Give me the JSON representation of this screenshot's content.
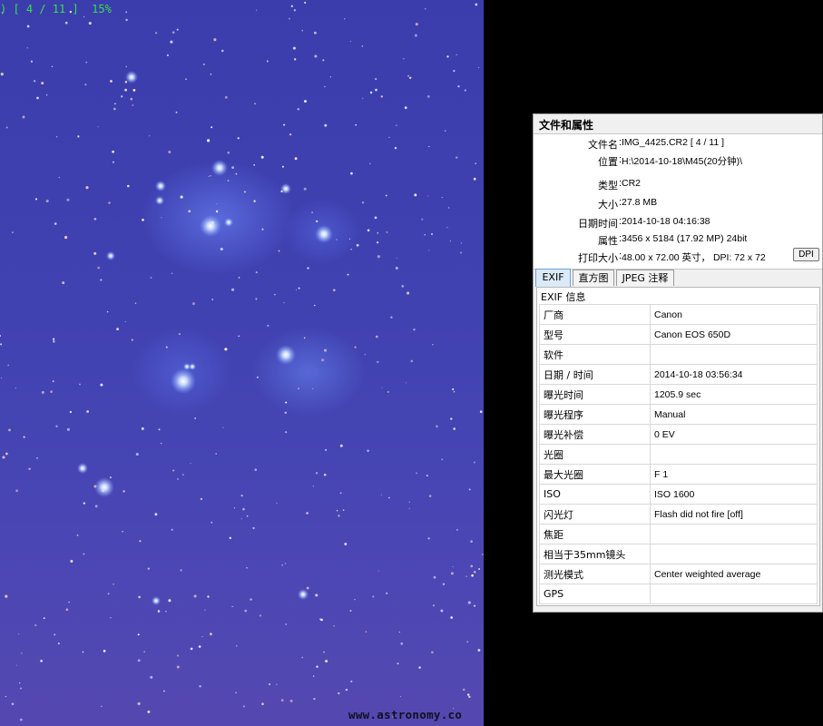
{
  "viewer": {
    "osd": ") [ 4 / 11 ]  15%",
    "watermark": "www.astronomy.co"
  },
  "panel": {
    "title": "文件和属性",
    "properties": [
      {
        "label": "文件名",
        "value": "IMG_4425.CR2   [ 4 / 11 ]"
      },
      {
        "label": "位置",
        "value": "H:\\2014-10-18\\M45(20分钟)\\"
      },
      {
        "label": "类型",
        "value": "CR2"
      },
      {
        "label": "大小",
        "value": "27.8 MB"
      },
      {
        "label": "日期时间",
        "value": "2014-10-18 04:16:38"
      },
      {
        "label": "属性",
        "value": "3456 x 5184 (17.92 MP)  24bit"
      },
      {
        "label": "打印大小",
        "value": "48.00 x 72.00 英寸，  DPI: 72 x 72"
      }
    ],
    "dpi_button": "DPI",
    "tabs": [
      "EXIF",
      "直方图",
      "JPEG 注释"
    ],
    "active_tab": "EXIF",
    "exif_heading": "EXIF 信息",
    "exif": [
      {
        "key": "厂商",
        "value": "Canon"
      },
      {
        "key": "型号",
        "value": "Canon EOS 650D"
      },
      {
        "key": "软件",
        "value": ""
      },
      {
        "key": "日期 / 时间",
        "value": "2014-10-18 03:56:34"
      },
      {
        "key": "曝光时间",
        "value": "1205.9 sec"
      },
      {
        "key": "曝光程序",
        "value": "Manual"
      },
      {
        "key": "曝光补偿",
        "value": "0 EV"
      },
      {
        "key": "光圈",
        "value": ""
      },
      {
        "key": "最大光圈",
        "value": "F 1"
      },
      {
        "key": "ISO",
        "value": "ISO 1600"
      },
      {
        "key": "闪光灯",
        "value": "Flash did not fire [off]"
      },
      {
        "key": "焦距",
        "value": ""
      },
      {
        "key": "相当于35mm镜头",
        "value": ""
      },
      {
        "key": "测光模式",
        "value": "Center weighted average"
      },
      {
        "key": "GPS",
        "value": ""
      }
    ]
  }
}
